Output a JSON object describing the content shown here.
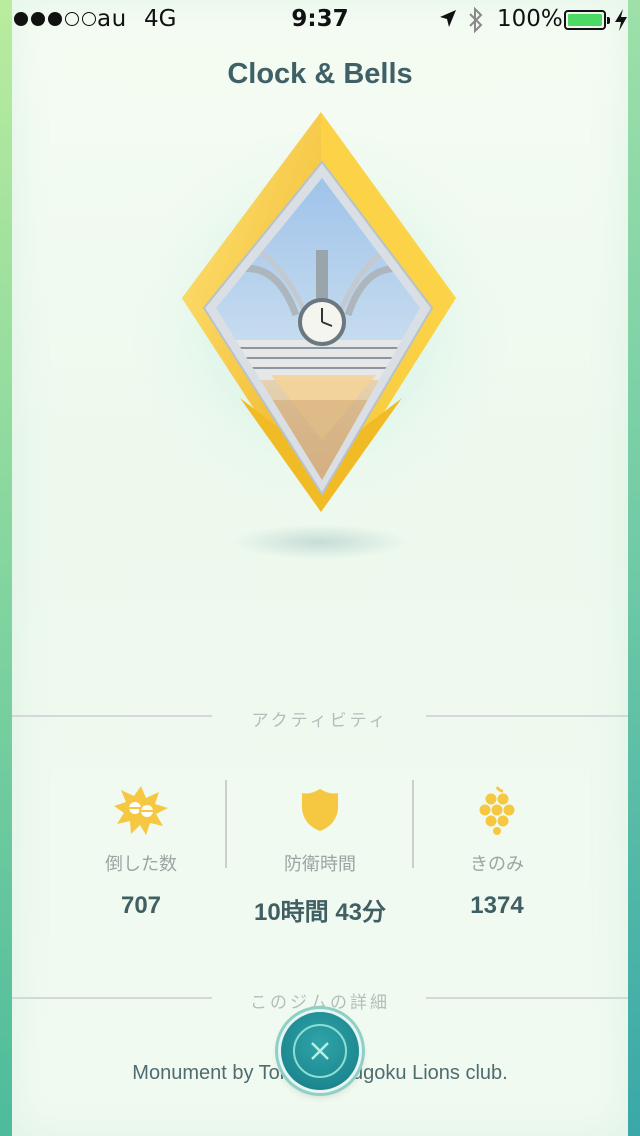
{
  "status_bar": {
    "signal_dots": [
      true,
      true,
      true,
      false,
      false
    ],
    "carrier": "au",
    "network": "4G",
    "time": "9:37",
    "battery_percent_text": "100%",
    "battery_level": 1.0,
    "icons": [
      "location-arrow-icon",
      "bluetooth-icon",
      "battery-icon",
      "charging-bolt-icon"
    ]
  },
  "gym": {
    "name": "Clock & Bells",
    "badge_color": "#f5c531"
  },
  "activity": {
    "section_title": "アクティビティ",
    "stats": [
      {
        "icon": "battle-burst-icon",
        "label": "倒した数",
        "value": "707"
      },
      {
        "icon": "shield-icon",
        "label": "防衛時間",
        "value": "10時間 43分"
      },
      {
        "icon": "berry-icon",
        "label": "きのみ",
        "value": "1374"
      }
    ]
  },
  "details": {
    "section_title": "このジムの詳細",
    "description": "Monument by Tokyo Ryougoku Lions club."
  },
  "close_button": {
    "icon": "close-icon",
    "color": "#1d8890"
  }
}
